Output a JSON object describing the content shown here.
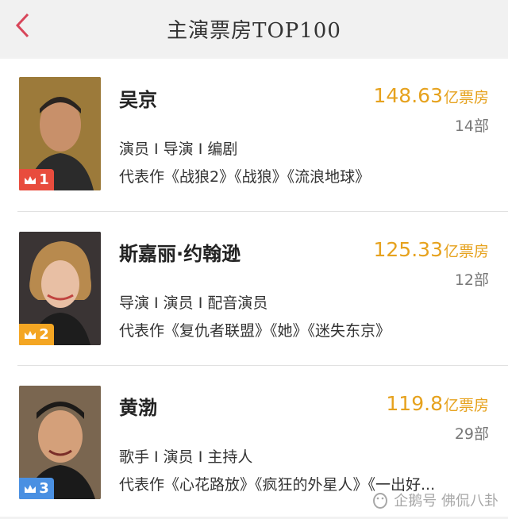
{
  "header": {
    "title": "主演票房TOP100"
  },
  "colors": {
    "accent": "#e6a21e",
    "back": "#d8465a",
    "rank1": "#e84c3d",
    "rank2": "#f4a623",
    "rank3": "#4a90e2"
  },
  "actors": [
    {
      "rank": "1",
      "name": "吴京",
      "box_office": "148.63",
      "unit": "亿票房",
      "count": "14部",
      "roles": "演员 I 导演 I 编剧",
      "works": "代表作《战狼2》《战狼》《流浪地球》"
    },
    {
      "rank": "2",
      "name": "斯嘉丽·约翰逊",
      "box_office": "125.33",
      "unit": "亿票房",
      "count": "12部",
      "roles": "导演 I 演员 I 配音演员",
      "works": "代表作《复仇者联盟》《她》《迷失东京》"
    },
    {
      "rank": "3",
      "name": "黄渤",
      "box_office": "119.8",
      "unit": "亿票房",
      "count": "29部",
      "roles": "歌手 I 演员 I 主持人",
      "works": "代表作《心花路放》《疯狂的外星人》《一出好..."
    }
  ],
  "watermark": {
    "text": "企鹅号 佛侃八卦",
    "icon": "penguin-icon"
  }
}
